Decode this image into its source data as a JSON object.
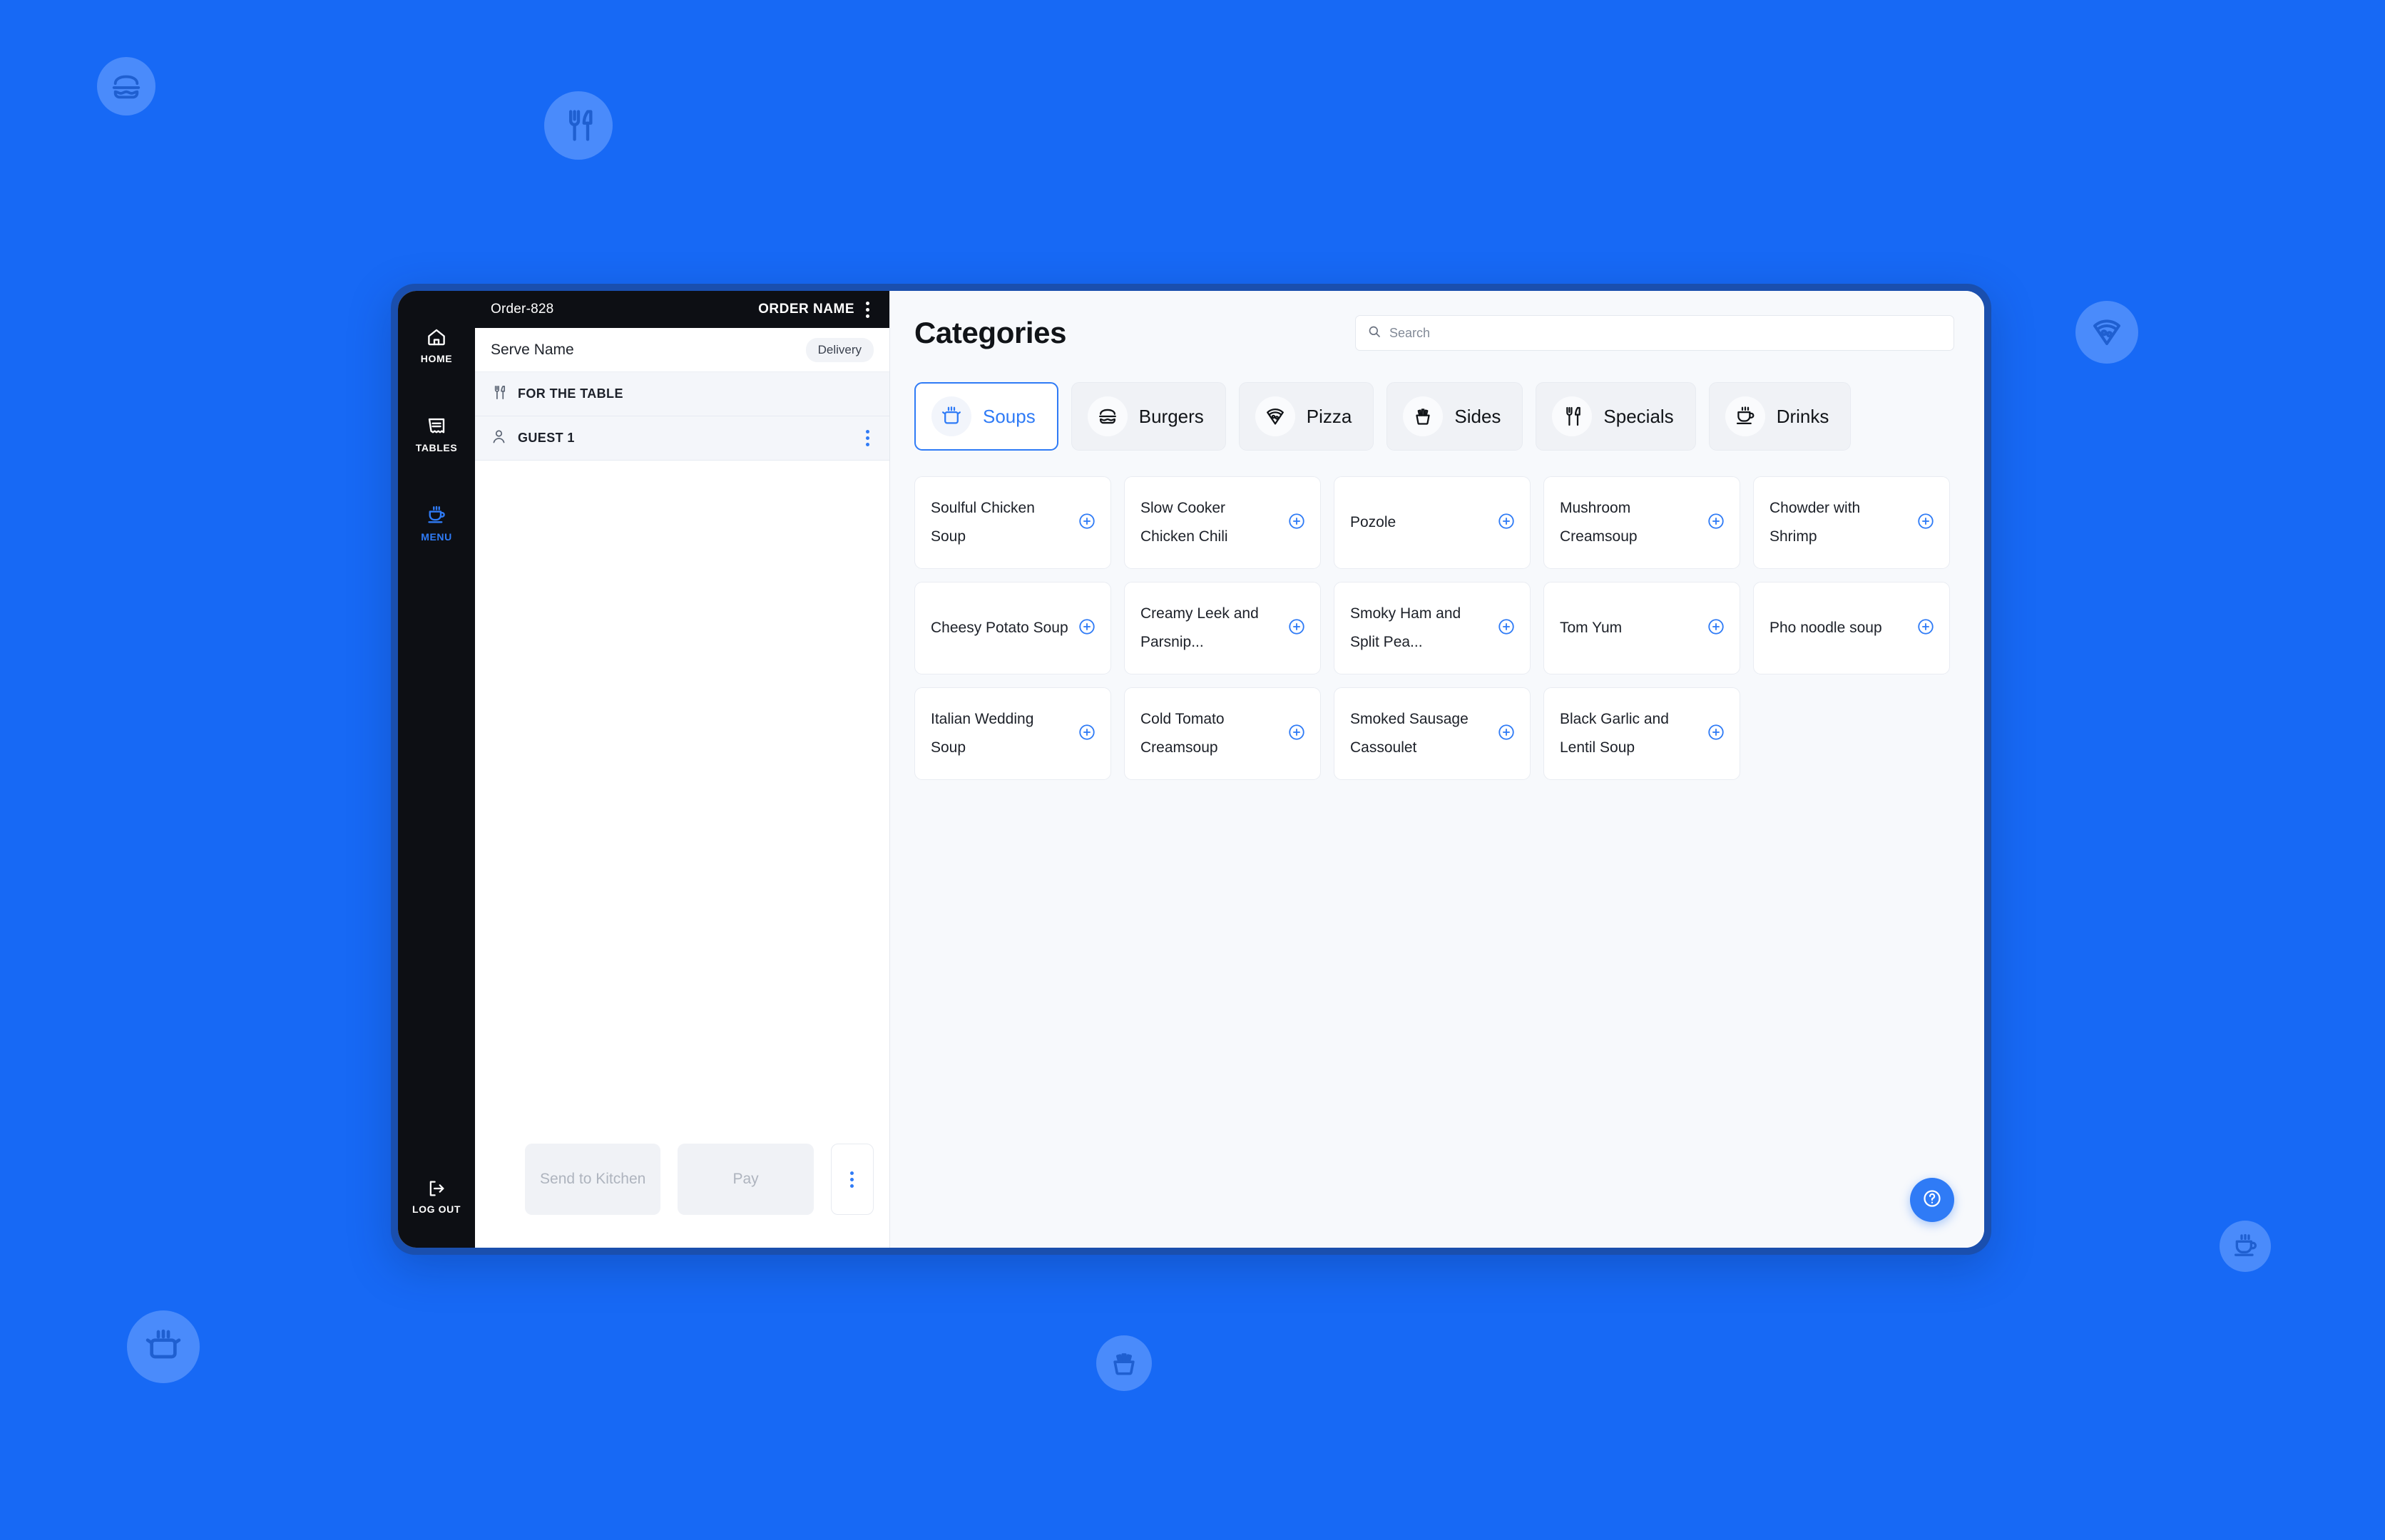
{
  "background": {
    "color": "#1769f5",
    "circle_color": "#4a8bfb",
    "glyph_color": "#1f5fd0",
    "icons": [
      {
        "name": "burger-icon",
        "label": "burger"
      },
      {
        "name": "fork-knife-icon",
        "label": "fork-knife"
      },
      {
        "name": "pizza-icon",
        "label": "pizza"
      },
      {
        "name": "pot-icon",
        "label": "pot"
      },
      {
        "name": "fries-icon",
        "label": "fries"
      },
      {
        "name": "cup-icon",
        "label": "cup"
      }
    ]
  },
  "window": {
    "frame_color": "#1a4fae",
    "canvas_color": "#f7f9fc"
  },
  "rail": {
    "items": [
      {
        "label": "HOME",
        "icon": "home-icon",
        "active": false
      },
      {
        "label": "TABLES",
        "icon": "receipt-icon",
        "active": false
      },
      {
        "label": "MENU",
        "icon": "cup-icon",
        "active": true
      }
    ],
    "logout": {
      "label": "LOG OUT",
      "icon": "logout-icon"
    },
    "active_color": "#2f7bf6"
  },
  "order": {
    "id": "Order-828",
    "name_label": "ORDER NAME",
    "serve_name": "Serve Name",
    "delivery_chip": "Delivery",
    "rows": [
      {
        "label": "FOR THE TABLE",
        "icon": "fork-knife-icon",
        "has_kebab": false
      },
      {
        "label": "GUEST 1",
        "icon": "person-icon",
        "has_kebab": true
      }
    ],
    "actions": {
      "send_to_kitchen": "Send to Kitchen",
      "pay": "Pay",
      "more_icon": "kebab-icon"
    }
  },
  "main": {
    "title": "Categories",
    "search": {
      "placeholder": "Search",
      "value": "",
      "icon": "search-icon"
    },
    "categories": [
      {
        "label": "Soups",
        "icon": "pot-icon",
        "active": true
      },
      {
        "label": "Burgers",
        "icon": "burger-icon",
        "active": false
      },
      {
        "label": "Pizza",
        "icon": "pizza-icon",
        "active": false
      },
      {
        "label": "Sides",
        "icon": "fries-icon",
        "active": false
      },
      {
        "label": "Specials",
        "icon": "fork-knife-icon",
        "active": false
      },
      {
        "label": "Drinks",
        "icon": "cup-icon",
        "active": false
      }
    ],
    "items": [
      {
        "name": "Soulful Chicken Soup"
      },
      {
        "name": "Slow Cooker Chicken Chili"
      },
      {
        "name": "Pozole"
      },
      {
        "name": "Mushroom Creamsoup"
      },
      {
        "name": "Chowder with Shrimp"
      },
      {
        "name": "Cheesy Potato Soup"
      },
      {
        "name": "Creamy Leek and Parsnip..."
      },
      {
        "name": "Smoky Ham and Split Pea..."
      },
      {
        "name": "Tom Yum"
      },
      {
        "name": "Pho noodle soup"
      },
      {
        "name": "Italian Wedding Soup"
      },
      {
        "name": "Cold Tomato Creamsoup"
      },
      {
        "name": "Smoked Sausage Cassoulet"
      },
      {
        "name": "Black Garlic and Lentil Soup"
      }
    ],
    "help": {
      "icon": "help-icon"
    },
    "accent_color": "#2f7bf6"
  }
}
